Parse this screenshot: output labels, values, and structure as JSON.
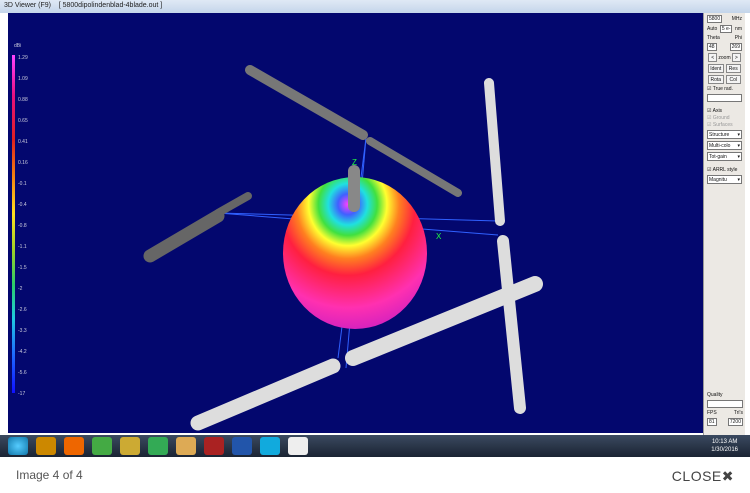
{
  "window": {
    "title": "3D Viewer (F9)    [ 5800dipolindenblad-4blade.out ]"
  },
  "legend": {
    "unit": "dBi",
    "values": [
      "1.29",
      "1.09",
      "0.88",
      "0.65",
      "0.41",
      "0.16",
      "-0.1",
      "-0.4",
      "-0.8",
      "-1.1",
      "-1.5",
      "-2",
      "-2.6",
      "-3.3",
      "-4.2",
      "-5.6",
      "-17"
    ]
  },
  "axes": {
    "z": "Z",
    "x": "X"
  },
  "panel": {
    "freq": "5800",
    "freq_unit": "MHz",
    "auto_label": "Auto",
    "auto_value": "5 e-",
    "auto_unit": "nm",
    "theta_label": "Theta",
    "phi_label": "Phi",
    "theta": "48",
    "phi": "269",
    "zoom_left": "<",
    "zoom_label": "zoom",
    "zoom_right": ">",
    "ident": "Ident",
    "res": "Res",
    "rota": "Rota",
    "col": "Col",
    "true_rad": "True rad.",
    "axis": "Axis",
    "ground": "Ground",
    "surfaces": "Surfaces",
    "display": "Structure",
    "color": "Multi-colo",
    "gain": "Tot-gain",
    "arrl": "ARRL style",
    "mag": "Magnitu",
    "quality": "Quality",
    "fps_label": "FPS",
    "tris_label": "Tri's",
    "fps": "81",
    "tris": "7200"
  },
  "taskbar": {
    "time": "10:13 AM",
    "date": "1/30/2016"
  },
  "footer": {
    "caption": "Image 4 of 4",
    "close": "CLOSE"
  }
}
